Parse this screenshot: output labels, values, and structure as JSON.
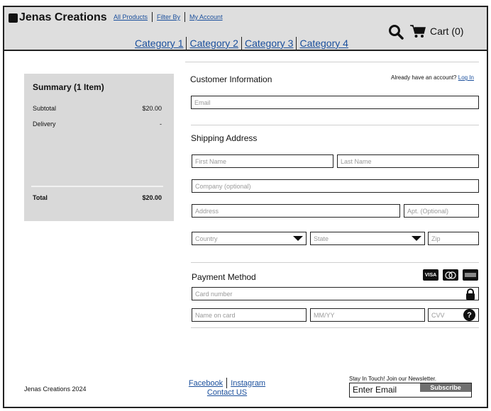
{
  "header": {
    "brand": "Jenas Creations",
    "top_links": [
      "All Products",
      "Filter By",
      "My Account"
    ],
    "categories": [
      "Category 1",
      "Category 2",
      "Category 3",
      "Category 4"
    ],
    "cart_label": "Cart (0)"
  },
  "summary": {
    "title": "Summary (1 Item)",
    "subtotal_label": "Subtotal",
    "subtotal_value": "$20.00",
    "delivery_label": "Delivery",
    "delivery_value": "-",
    "total_label": "Total",
    "total_value": "$20.00"
  },
  "customer": {
    "title": "Customer Information",
    "account_prompt": "Already have an account?",
    "login_link": "Log In",
    "email_placeholder": "Email"
  },
  "shipping": {
    "title": "Shipping Address",
    "first_name": "First Name",
    "last_name": "Last Name",
    "company": "Company (optional)",
    "address": "Address",
    "apt": "Apt. (Optional)",
    "country": "Country",
    "state": "State",
    "zip": "Zip"
  },
  "payment": {
    "title": "Payment Method",
    "card_number": "Card number",
    "name_on_card": "Name on card",
    "expiry": "MM/YY",
    "cvv": "CVV",
    "card_logos": [
      "VISA",
      "MC",
      "AMEX"
    ]
  },
  "footer": {
    "copyright": "Jenas Creations 2024",
    "facebook": "Facebook",
    "instagram": "Instagram",
    "contact": "Contact US",
    "newsletter_label": "Stay In Touch! Join our Newsletter.",
    "newsletter_value": "Enter Email",
    "subscribe": "Subscribe"
  }
}
